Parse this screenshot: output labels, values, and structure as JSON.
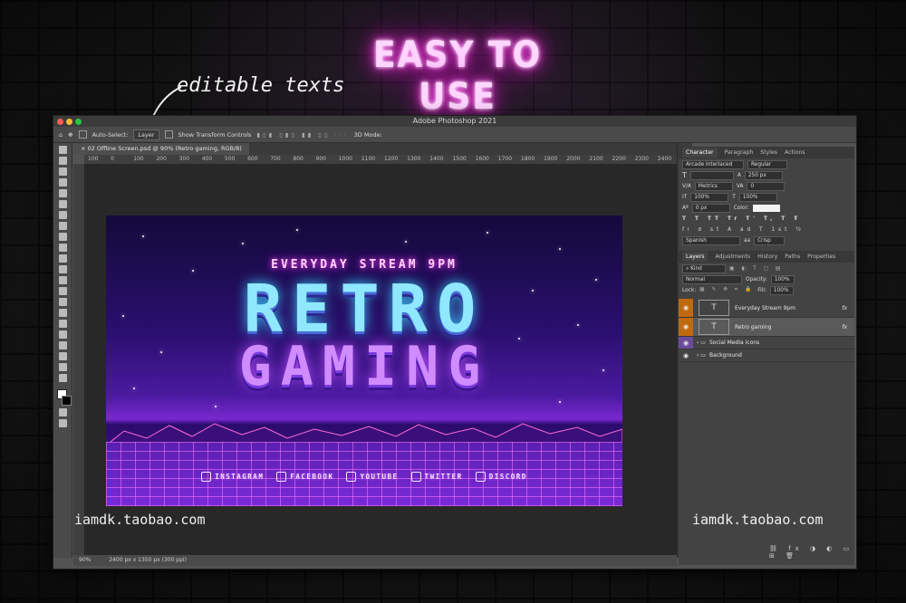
{
  "headline": "EASY TO USE",
  "annotation": "editable texts",
  "watermark": "iamdk.taobao.com",
  "window": {
    "title": "Adobe Photoshop 2021",
    "doc_tab": "02 Offline Screen.psd @ 90% (Retro gaming, RGB/8)",
    "options": {
      "auto_select": "Auto-Select:",
      "auto_select_value": "Layer",
      "show_transform": "Show Transform Controls",
      "mode_3d": "3D Mode:"
    },
    "ruler": [
      "100",
      "0",
      "100",
      "200",
      "300",
      "400",
      "500",
      "600",
      "700",
      "800",
      "900",
      "1000",
      "1100",
      "1200",
      "1300",
      "1400",
      "1500",
      "1600",
      "1700",
      "1800",
      "1900",
      "2000",
      "2100",
      "2200",
      "2300",
      "2400"
    ],
    "status": {
      "zoom": "90%",
      "doc_info": "2400 px x 1350 px (300 ppi)"
    }
  },
  "artwork": {
    "stream_text": "EVERYDAY STREAM 9PM",
    "title_line1": "RETRO",
    "title_line2": "GAMING",
    "social": [
      "INSTAGRAM",
      "FACEBOOK",
      "YOUTUBE",
      "TWITTER",
      "DISCORD"
    ]
  },
  "character_panel": {
    "tabs": [
      "Character",
      "Paragraph",
      "Styles",
      "Actions"
    ],
    "font_family": "Arcade Interlaced",
    "font_style": "Regular",
    "leading": "250 px",
    "kerning": "Metrics",
    "tracking": "0",
    "vscale": "100%",
    "hscale": "100%",
    "baseline": "0 px",
    "color_label": "Color:",
    "language": "Spanish",
    "antialias": "Crisp"
  },
  "layers_panel": {
    "tabs": [
      "Layers",
      "Adjustments",
      "History",
      "Paths",
      "Properties"
    ],
    "kind": "Kind",
    "blend": "Normal",
    "opacity_label": "Opacity:",
    "opacity": "100%",
    "lock_label": "Lock:",
    "fill_label": "Fill:",
    "fill": "100%",
    "layers": [
      {
        "name": "Everyday Stream 9pm",
        "fx": "fx"
      },
      {
        "name": "Retro gaming",
        "fx": "fx"
      },
      {
        "name": "Social Media icons"
      },
      {
        "name": "Background"
      }
    ]
  },
  "colors": {
    "neon": "#ff2ad8",
    "layer_eye": "#c06a10",
    "group_eye": "#6a4a9a"
  }
}
